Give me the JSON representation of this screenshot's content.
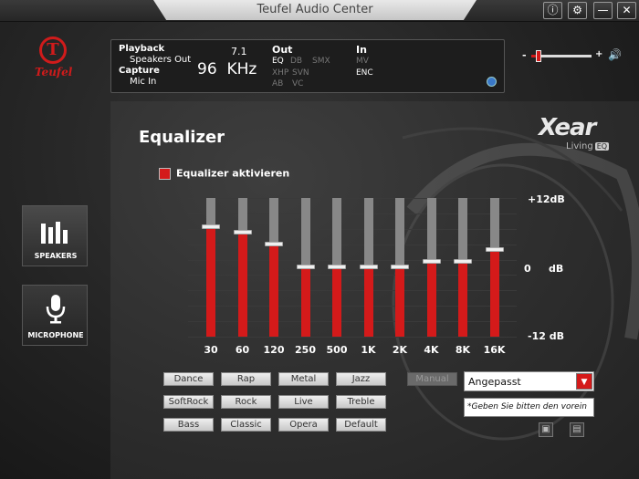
{
  "window": {
    "title": "Teufel Audio Center"
  },
  "titlebar_buttons": [
    {
      "name": "info",
      "glyph": "ⓘ"
    },
    {
      "name": "settings",
      "glyph": "⚙"
    },
    {
      "name": "minimize",
      "glyph": "—"
    },
    {
      "name": "close",
      "glyph": "✕"
    }
  ],
  "brand": {
    "wordmark": "Teufel",
    "mark": "T",
    "color": "#d01b1b"
  },
  "status": {
    "playback_label": "Playback",
    "playback_device": "Speakers Out",
    "capture_label": "Capture",
    "capture_device": "Mic In",
    "channels": "7.1",
    "rate": "96",
    "rate_unit": "KHz",
    "out_label": "Out",
    "out_items": [
      {
        "label": "EQ",
        "active": true
      },
      {
        "label": "DB",
        "active": false
      },
      {
        "label": "SMX",
        "active": false
      },
      {
        "label": "XHP",
        "active": false
      },
      {
        "label": "SVN",
        "active": false
      },
      {
        "label": "AB",
        "active": false
      },
      {
        "label": "VC",
        "active": false
      }
    ],
    "in_label": "In",
    "in_items": [
      {
        "label": "MV",
        "active": false
      },
      {
        "label": "ENC",
        "active": true
      }
    ]
  },
  "volume": {
    "minus": "-",
    "plus": "+",
    "level": 0.12
  },
  "nav": {
    "speakers_label": "SPEAKERS",
    "microphone_label": "MICROPHONE"
  },
  "equalizer": {
    "title": "Equalizer",
    "activate_label": "Equalizer aktivieren",
    "activated": true,
    "xear_logo": "Xear",
    "xear_sub": "Living",
    "xear_badge": "EQ",
    "db_labels": {
      "top": "+12dB",
      "mid": "0",
      "mid_unit": "dB",
      "bottom": "-12 dB"
    },
    "db_range": [
      -12,
      12
    ],
    "bands": [
      {
        "freq": "30",
        "gain": 7
      },
      {
        "freq": "60",
        "gain": 6
      },
      {
        "freq": "120",
        "gain": 4
      },
      {
        "freq": "250",
        "gain": 0
      },
      {
        "freq": "500",
        "gain": 0
      },
      {
        "freq": "1K",
        "gain": 0
      },
      {
        "freq": "2K",
        "gain": 0
      },
      {
        "freq": "4K",
        "gain": 1
      },
      {
        "freq": "8K",
        "gain": 1
      },
      {
        "freq": "16K",
        "gain": 3
      }
    ],
    "presets": [
      [
        "Dance",
        "Rap",
        "Metal",
        "Jazz"
      ],
      [
        "SoftRock",
        "Rock",
        "Live",
        "Treble"
      ],
      [
        "Bass",
        "Classic",
        "Opera",
        "Default"
      ]
    ],
    "manual_label": "Manual",
    "selected_preset": "Angepasst",
    "hint_text": "*Geben Sie bitten den vorein"
  },
  "colors": {
    "accent": "#d41a1a",
    "track": "#888888"
  }
}
